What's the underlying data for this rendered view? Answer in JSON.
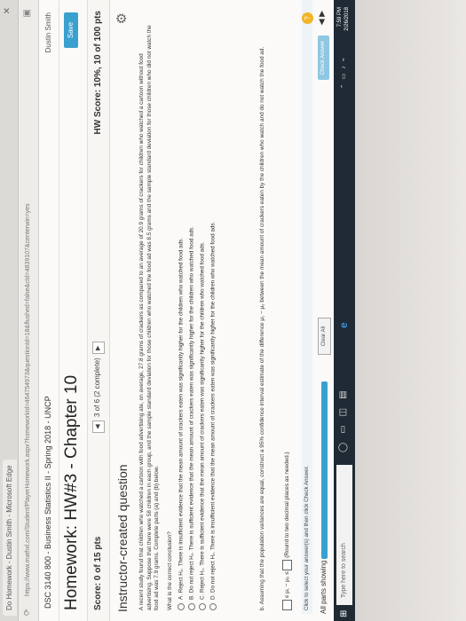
{
  "browser": {
    "tab_label": "Do Homework - Dustin Smith - Microsoft Edge",
    "url": "https://www.mathxl.com/Student/PlayerHomework.aspx?homeworkId=464754973&questionId=18&flushed=false&cId=4839107&centerwin=yes"
  },
  "course": {
    "title": "DSC 3140 800 - Business Statistics II - Spring 2018 - UNCP",
    "user": "Dustin Smith"
  },
  "homework": {
    "title": "Homework: HW#3 - Chapter 10",
    "save_label": "Save",
    "score_label": "Score: 0 of 15 pts",
    "question_nav": "3 of 6 (2 complete)",
    "hw_score": "HW Score: 10%, 10 of 100 pts",
    "question_title": "Instructor-created question"
  },
  "problem": {
    "text": "A recent study found that children who watched a cartoon with food advertising ate, on average, 27.8 grams of crackers as compared to an average of 20.9 grams of crackers for children who watched a cartoon without food advertising. Suppose that there were 58 children in each group, and the sample standard deviation for those children who watched the food ad was 8.5 grams and the sample standard deviation for those children who did not watch the food ad was 7.9 grams. Complete parts (a) and (b) below.",
    "conclusion_question": "What is the correct conclusion?",
    "options": [
      {
        "letter": "A.",
        "text": "Reject H₀. There is insufficient evidence that the mean amount of crackers eaten was significantly higher for the children who watched food ads."
      },
      {
        "letter": "B.",
        "text": "Do not reject H₀. There is sufficient evidence that the mean amount of crackers eaten was significantly higher for the children who watched food ads."
      },
      {
        "letter": "C.",
        "text": "Reject H₀. There is sufficient evidence that the mean amount of crackers eaten was significantly higher for the children who watched food ads."
      },
      {
        "letter": "D.",
        "text": "Do not reject H₀. There is insufficient evidence that the mean amount of crackers eaten was significantly higher for the children who watched food ads."
      }
    ],
    "part_b": "b. Assuming that the population variances are equal, construct a 95% confidence interval estimate of the difference μ₁ − μ₂ between the mean amount of crackers eaten by the children who watch and do not watch the food ad.",
    "ci_middle": "≤ μ₁ − μ₂ ≤",
    "ci_note": "(Round to two decimal places as needed.)"
  },
  "footer": {
    "instruction": "Click to select your answer(s) and then click Check Answer.",
    "all_parts": "All parts showing",
    "clear_all": "Clear All",
    "check_answer": "Check Answer",
    "help": "?"
  },
  "taskbar": {
    "search_placeholder": "Type here to search",
    "time": "7:59 PM",
    "date": "2/26/2018"
  }
}
